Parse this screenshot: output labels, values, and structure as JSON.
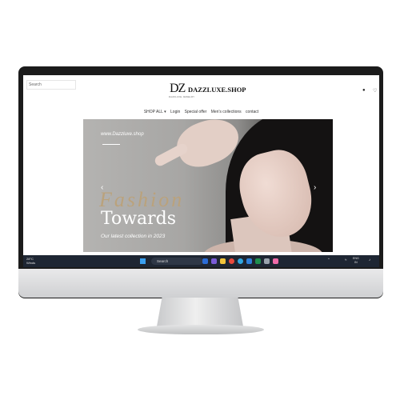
{
  "header": {
    "search_placeholder": "Search",
    "logo_mark": "DZ",
    "logo_tagline": "DAZZLUXE JEWELRY",
    "site_name": "DAZZLUXE.SHOP",
    "user_icon": "user-icon",
    "wishlist_icon": "heart-icon"
  },
  "nav": {
    "items": [
      "SHOP ALL ▾",
      "Login",
      "Special offer",
      "Men's collections",
      "contact"
    ]
  },
  "hero": {
    "site_url": "www.Dazzluxe.shop",
    "script_word": "Fashion",
    "title": "Towards",
    "subtitle": "Our latest collection in 2023",
    "prev_icon": "chevron-left-icon",
    "next_icon": "chevron-right-icon"
  },
  "taskbar": {
    "weather_temp": "28°C",
    "weather_desc": "Winds",
    "search_label": "Search",
    "apps": [
      "word",
      "meet",
      "files",
      "chrome",
      "edge",
      "vscode",
      "excel",
      "mail",
      "paint"
    ],
    "app_colors": [
      "#2b6cd6",
      "#7a5bd6",
      "#f2c43a",
      "#e84a3c",
      "#2fa6e0",
      "#2f7fd8",
      "#1f8f4e",
      "#9aa3ad",
      "#f06ba8"
    ],
    "clock_time": "ENG",
    "clock_date": "IN"
  },
  "colors": {
    "accent_gold": "#bba27a",
    "bezel": "#1b1b1b",
    "taskbar": "#1e2633"
  }
}
